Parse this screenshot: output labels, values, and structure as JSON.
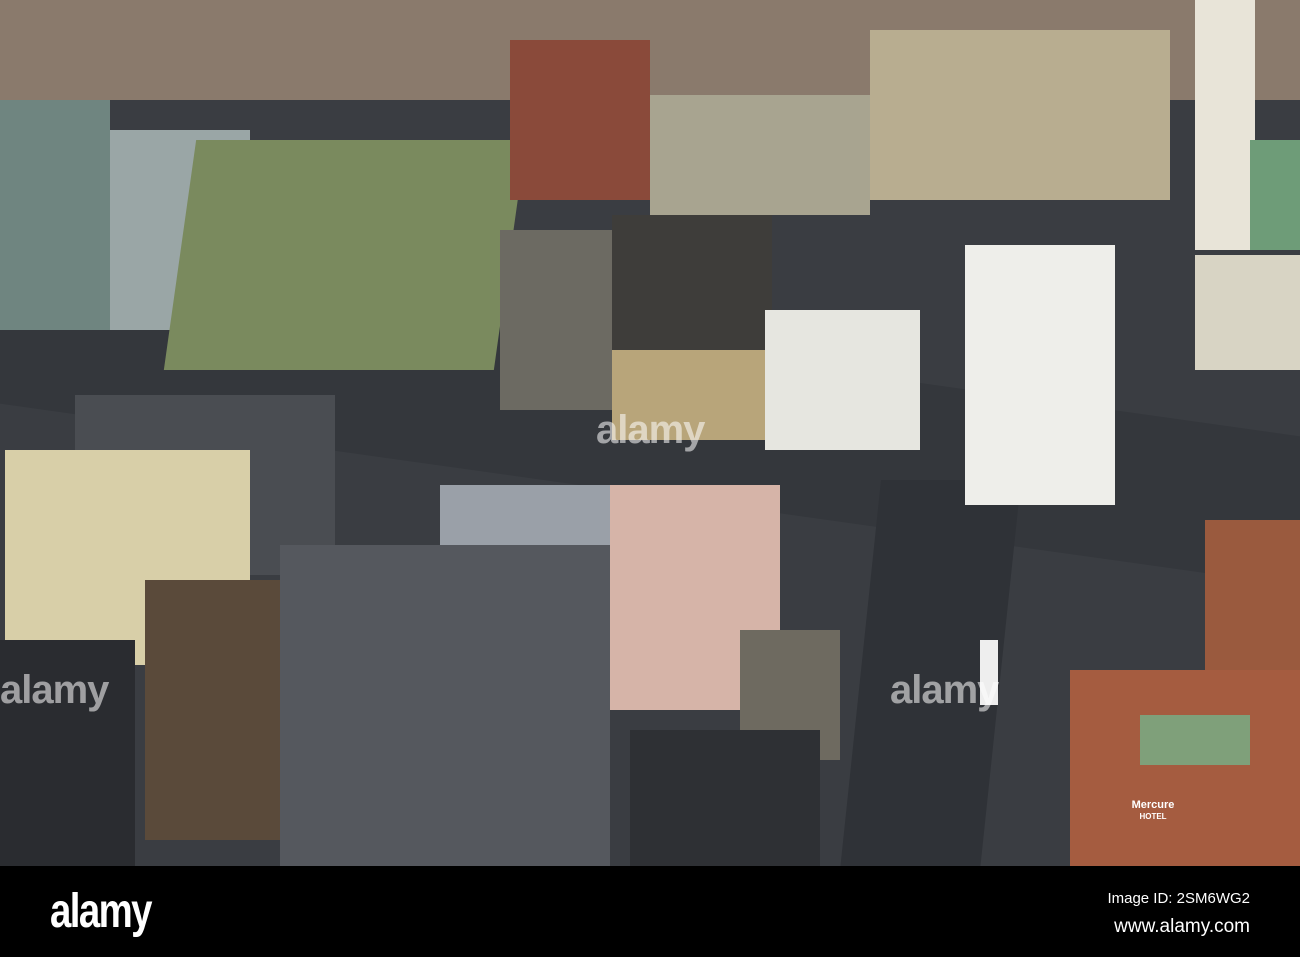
{
  "photo": {
    "subject": "aerial city view",
    "building_sign": {
      "brand": "Mercure",
      "sub": "HOTEL"
    },
    "watermark": "alamy"
  },
  "footer": {
    "logo": "alamy",
    "image_id": "Image ID: 2SM6WG2",
    "website": "www.alamy.com"
  },
  "colors": {
    "footer_bg": "#000000",
    "footer_text": "#ffffff"
  }
}
